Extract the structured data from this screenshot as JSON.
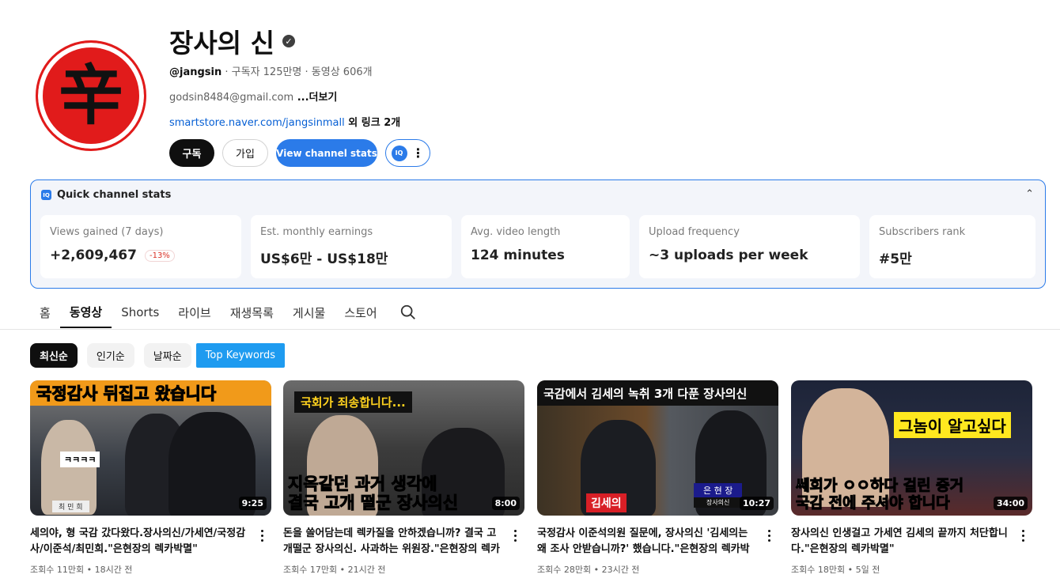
{
  "channel": {
    "avatar_char": "辛",
    "name": "장사의 신",
    "handle": "@jangsin",
    "subscribers": " · 구독자 125만명 · 동영상 606개",
    "email": "godsin8484@gmail.com",
    "more": " ...더보기",
    "link_url": "smartstore.naver.com/jangsinmall",
    "link_extra": " 외 링크 2개",
    "buttons": {
      "subscribe": "구독",
      "join": "가입",
      "stats": "View channel stats",
      "ext_icon": "IQ"
    }
  },
  "stats": {
    "title": "Quick channel stats",
    "icon": "IQ",
    "cards": [
      {
        "label": "Views gained (7 days)",
        "value": "+2,609,467",
        "change": "-13%"
      },
      {
        "label": "Est. monthly earnings",
        "value": "US$6만 - US$18만"
      },
      {
        "label": "Avg. video length",
        "value": "124 minutes"
      },
      {
        "label": "Upload frequency",
        "value": "~3 uploads per week"
      },
      {
        "label": "Subscribers rank",
        "value": "#5만"
      }
    ]
  },
  "tabs": [
    "홈",
    "동영상",
    "Shorts",
    "라이브",
    "재생목록",
    "게시물",
    "스토어"
  ],
  "chips": [
    "최신순",
    "인기순",
    "날짜순",
    "Top Keywords"
  ],
  "videos": [
    {
      "thumb_top": "국정감사 뒤집고 왔습니다",
      "thumb_mid": "ㅋㅋㅋㅋ",
      "thumb_bottom": "최 민 희",
      "duration": "9:25",
      "title": "세의야, 형 국감 갔다왔다.장사의신/가세연/국정감사/이준석/최민희.\"은현장의 렉카박멸\"",
      "meta": "조회수 11만회 • 18시간 전"
    },
    {
      "thumb_top": "국회가 죄송합니다...",
      "thumb_bottom_1": "지옥같던 과거 생각에",
      "thumb_bottom_2": "결국 고개 떨군 장사의신",
      "duration": "8:00",
      "title": "돈을 쓸어담는데 렉카질을 안하겠습니까? 결국 고개떨군 장사의신. 사과하는 위원장.\"은현장의 렉카박멸\"",
      "meta": "조회수 17만회 • 21시간 전"
    },
    {
      "thumb_top": "국감에서 김세의 녹취 3개 다푼 장사의신",
      "thumb_tag": "김세의",
      "thumb_name": "은 현 장",
      "thumb_sub": "장사의신",
      "duration": "10:27",
      "title": "국정감사 이준석의원 질문에, 장사의신 '김세의는 왜 조사 안받습니까?' 했습니다.\"은현장의 렉카박멸\"",
      "meta": "조회수 28만회 • 23시간 전"
    },
    {
      "thumb_top": "그놈이 알고싶다",
      "thumb_bottom_1": "쎄희가 ㅇㅇ하다 걸린 증거",
      "thumb_bottom_2": "국감 전에 주셔야 합니다",
      "duration": "34:00",
      "title": "장사의신 인생걸고 가세연 김세의 끝까지 처단합니다.\"은현장의 렉카박멸\"",
      "meta": "조회수 18만회 • 5일 전"
    }
  ]
}
